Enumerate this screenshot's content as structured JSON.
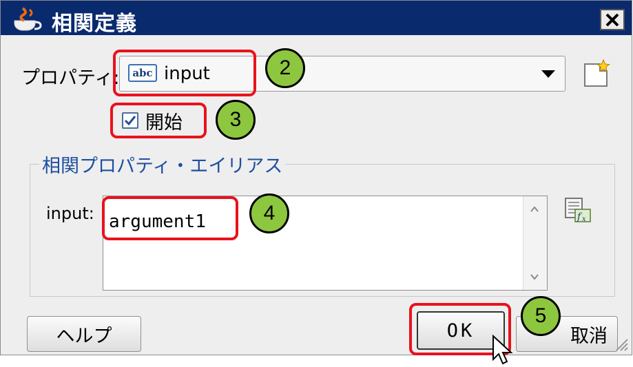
{
  "dialog": {
    "title": "相関定義",
    "close_label": "✕"
  },
  "property": {
    "label": "プロパティ:",
    "type_badge": "abc",
    "value": "input"
  },
  "start": {
    "label": "開始",
    "checked": true
  },
  "alias_group": {
    "title": "相関プロパティ・エイリアス",
    "input_label": "input:",
    "input_value": "argument1"
  },
  "buttons": {
    "help": "ヘルプ",
    "ok": "OK",
    "cancel": "取消"
  },
  "callouts": [
    "2",
    "3",
    "4",
    "5"
  ],
  "colors": {
    "titlebar": "#0a2a6e",
    "highlight": "#e8121d",
    "callout": "#8dc63f",
    "group_title": "#1d4fa0"
  }
}
